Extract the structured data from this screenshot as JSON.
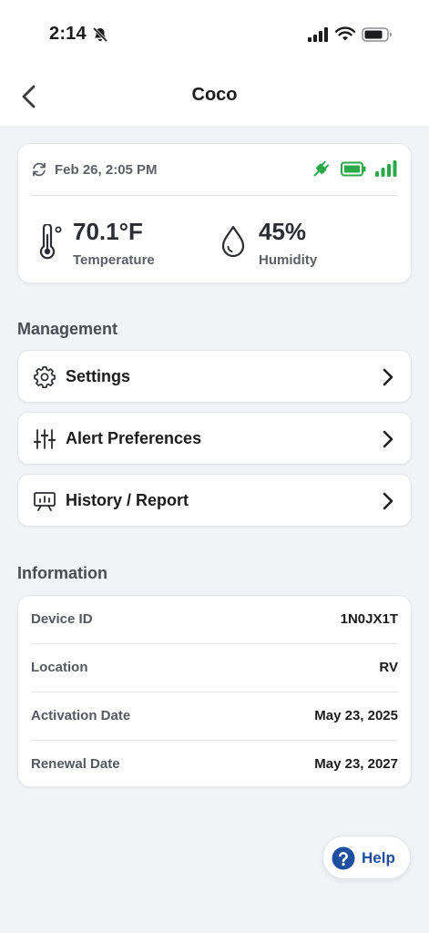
{
  "status_bar": {
    "time": "2:14"
  },
  "nav": {
    "title": "Coco"
  },
  "reading": {
    "timestamp": "Feb 26, 2:05 PM",
    "temperature_value": "70.1°F",
    "temperature_label": "Temperature",
    "humidity_value": "45%",
    "humidity_label": "Humidity"
  },
  "management": {
    "title": "Management",
    "items": [
      {
        "label": "Settings",
        "icon": "gear-icon"
      },
      {
        "label": "Alert Preferences",
        "icon": "sliders-icon"
      },
      {
        "label": "History / Report",
        "icon": "presentation-chart-icon"
      }
    ]
  },
  "information": {
    "title": "Information",
    "rows": [
      {
        "key": "Device ID",
        "value": "1N0JX1T"
      },
      {
        "key": "Location",
        "value": "RV"
      },
      {
        "key": "Activation Date",
        "value": "May 23, 2025"
      },
      {
        "key": "Renewal Date",
        "value": "May 23, 2027"
      }
    ]
  },
  "help": {
    "label": "Help"
  },
  "colors": {
    "status_green": "#2aa84a",
    "help_blue": "#1f4f9e",
    "background": "#f2f3f7"
  }
}
